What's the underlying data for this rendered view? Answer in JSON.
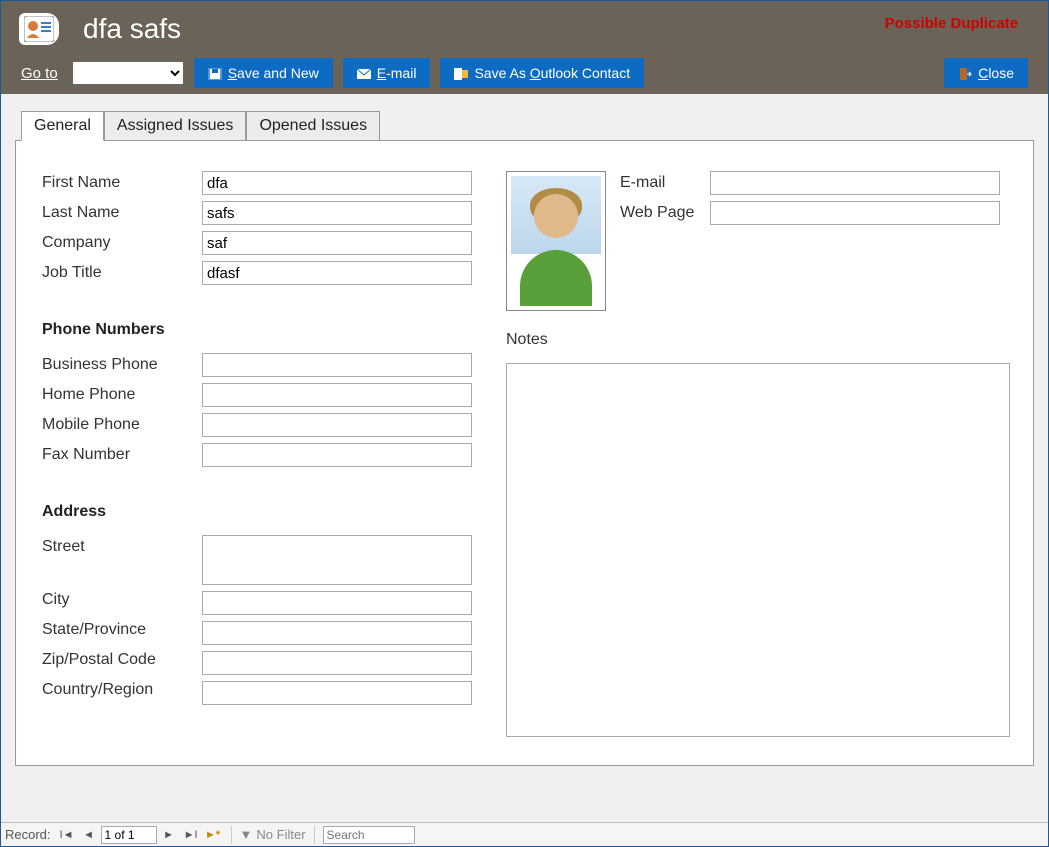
{
  "header": {
    "title": "dfa safs",
    "duplicate_warning": "Possible Duplicate"
  },
  "toolbar": {
    "goto_label": "Go to",
    "goto_prefix_underline": "G",
    "goto_suffix": "o to",
    "goto_value": "",
    "save_new": "Save and New",
    "save_new_underline": "S",
    "save_new_rest": "ave and New",
    "email": "E-mail",
    "email_underline": "E",
    "email_rest": "-mail",
    "outlook": "Save As Outlook Contact",
    "outlook_pre": "Save As ",
    "outlook_underline": "O",
    "outlook_rest": "utlook Contact",
    "close": "Close",
    "close_underline": "C",
    "close_rest": "lose"
  },
  "tabs": {
    "general": "General",
    "assigned": "Assigned Issues",
    "opened": "Opened Issues"
  },
  "labels": {
    "first_name": "First Name",
    "last_name": "Last Name",
    "company": "Company",
    "job_title": "Job Title",
    "phone_section": "Phone Numbers",
    "business_phone": "Business Phone",
    "home_phone": "Home Phone",
    "mobile_phone": "Mobile Phone",
    "fax_number": "Fax Number",
    "address_section": "Address",
    "street": "Street",
    "city": "City",
    "state": "State/Province",
    "zip": "Zip/Postal Code",
    "country": "Country/Region",
    "email": "E-mail",
    "web": "Web Page",
    "notes": "Notes"
  },
  "values": {
    "first_name": "dfa",
    "last_name": "safs",
    "company": "saf",
    "job_title": "dfasf",
    "business_phone": "",
    "home_phone": "",
    "mobile_phone": "",
    "fax_number": "",
    "street": "",
    "city": "",
    "state": "",
    "zip": "",
    "country": "",
    "email": "",
    "web": "",
    "notes": ""
  },
  "statusbar": {
    "record_label": "Record:",
    "record_value": "1 of 1",
    "no_filter": "No Filter",
    "search_placeholder": "Search"
  }
}
